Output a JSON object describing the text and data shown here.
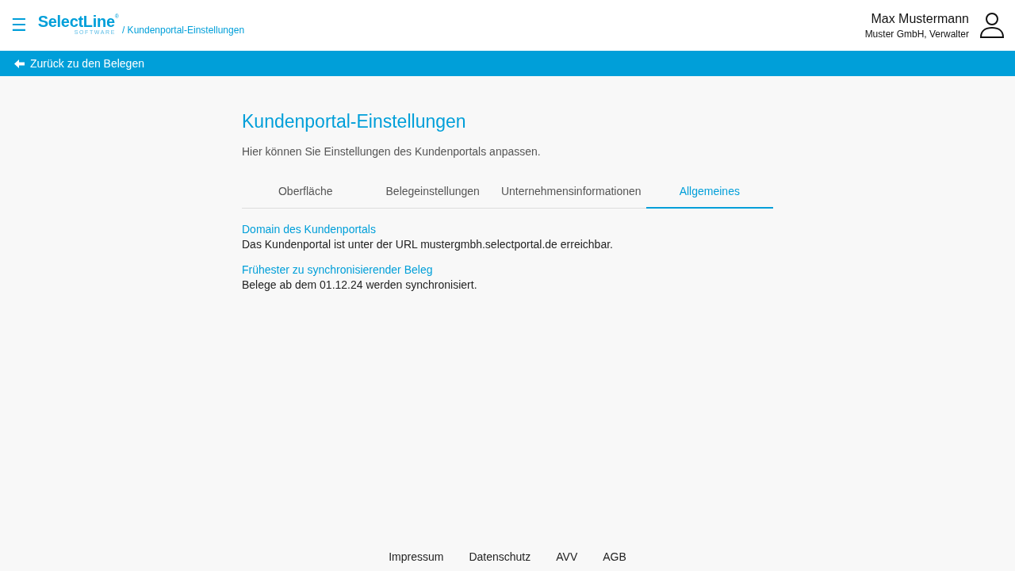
{
  "header": {
    "menu_icon": "☰",
    "logo": {
      "name": "SelectLine",
      "mark": "®",
      "tagline": "SOFTWARE"
    },
    "breadcrumb": "/ Kundenportal-Einstellungen",
    "user": {
      "name": "Max Mustermann",
      "subtitle": "Muster GmbH, Verwalter"
    }
  },
  "back_bar": {
    "label": "Zurück zu den Belegen"
  },
  "page": {
    "title": "Kundenportal-Einstellungen",
    "description": "Hier können Sie Einstellungen des Kundenportals anpassen.",
    "tabs": [
      {
        "label": "Oberfläche",
        "selected": false
      },
      {
        "label": "Belegeinstellungen",
        "selected": false
      },
      {
        "label": "Unternehmensinformationen",
        "selected": false
      },
      {
        "label": "Allgemeines",
        "selected": true
      }
    ],
    "sections": [
      {
        "heading": "Domain des Kundenportals",
        "text": "Das Kundenportal ist unter der URL mustergmbh.selectportal.de erreichbar."
      },
      {
        "heading": "Frühester zu synchronisierender Beleg",
        "text": "Belege ab dem 01.12.24 werden synchronisiert."
      }
    ]
  },
  "footer": {
    "links": [
      "Impressum",
      "Datenschutz",
      "AVV",
      "AGB"
    ]
  }
}
